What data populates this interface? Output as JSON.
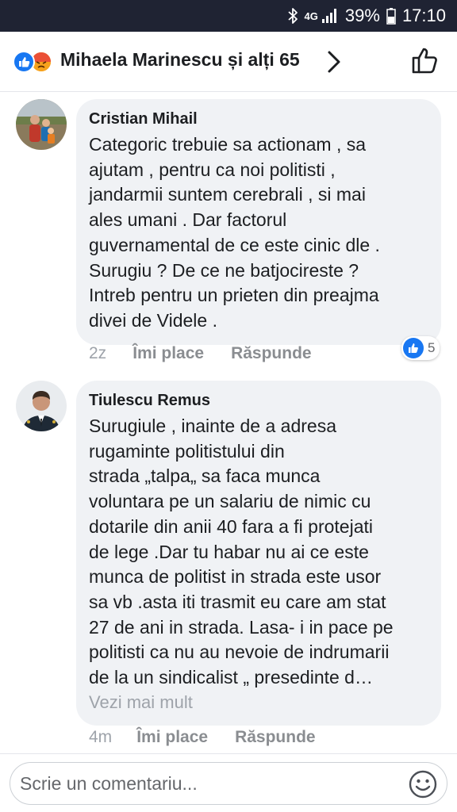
{
  "status_bar": {
    "network": "4G",
    "battery": "39%",
    "time": "17:10",
    "icons": [
      "bluetooth-icon",
      "signal-icon",
      "battery-icon"
    ]
  },
  "reactions": {
    "title": "Mihaela Marinescu și alți 65",
    "reaction_icons": [
      "like-reaction-icon",
      "angry-reaction-icon"
    ]
  },
  "comments": [
    {
      "author": "Cristian Mihail",
      "text": "Categoric trebuie sa actionam , sa\najutam , pentru ca noi politisti ,\njandarmii suntem cerebrali , si mai\nales umani . Dar factorul\nguvernamental de ce este cinic dle .\nSurugiu ? De ce ne batjocireste ?\nIntreb pentru un prieten din preajma\ndivei de Videle .",
      "time": "2z",
      "like_label": "Îmi place",
      "reply_label": "Răspunde",
      "like_count": "5"
    },
    {
      "author": "Tiulescu Remus",
      "text": "Surugiule , inainte de a adresa\nrugaminte    politistului din\nstrada „talpa„ sa faca munca\nvoluntara pe un salariu de nimic cu\ndotarile din anii 40 fara a fi protejati\nde lege .Dar tu habar nu ai ce este\nmunca de politist in strada este usor\nsa vb .asta iti trasmit eu care am stat\n27 de ani in strada. Lasa- i in pace pe\npolitisti ca nu au nevoie de indrumarii\nde la un sindicalist „ presedinte d…",
      "see_more": "Vezi mai mult",
      "time": "4m",
      "like_label": "Îmi place",
      "reply_label": "Răspunde"
    }
  ],
  "composer": {
    "placeholder": "Scrie un comentariu..."
  },
  "colors": {
    "accent": "#1877f2",
    "bubble": "#f0f2f5",
    "status_bar": "#1f2333"
  }
}
